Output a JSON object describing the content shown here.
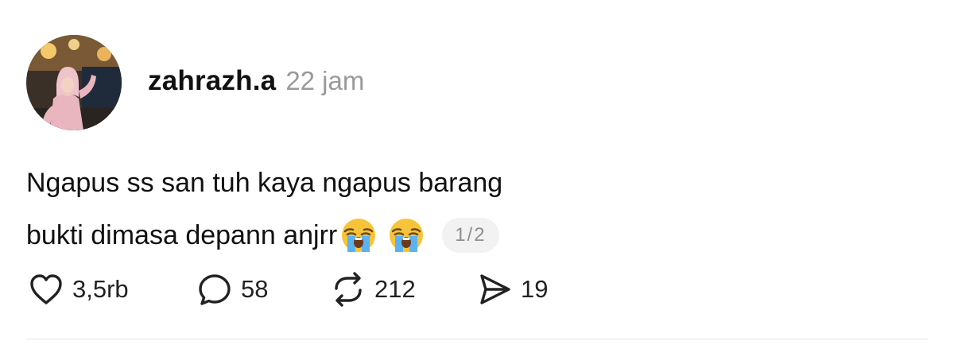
{
  "post": {
    "username": "zahrazh.a",
    "timestamp": "22 jam",
    "text_lines": [
      "Ngapus ss san tuh kaya ngapus barang",
      "bukti dimasa depann anjrr"
    ],
    "emojis": [
      "loudly-crying-face-emoji",
      "loudly-crying-face-emoji"
    ],
    "page_indicator": "1/2"
  },
  "actions": {
    "likes": "3,5rb",
    "comments": "58",
    "reposts": "212",
    "shares": "19"
  },
  "icons": {
    "like": "heart-icon",
    "comment": "comment-bubble-icon",
    "repost": "repost-icon",
    "share": "send-icon"
  },
  "colors": {
    "text": "#111111",
    "muted": "#9a9a9a",
    "badge_bg": "#f2f2f2",
    "divider": "#e6e6e6"
  }
}
